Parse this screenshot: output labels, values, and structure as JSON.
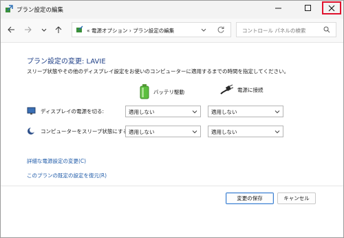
{
  "window": {
    "title": "プラン設定の編集"
  },
  "nav": {
    "address": "« 電源オプション  ›  プラン設定の編集",
    "search_placeholder": "コントロール パネルの検索"
  },
  "main": {
    "heading": "プラン設定の変更: LAVIE",
    "description": "スリープ状態やその他のディスプレイ設定をお使いのコンピューターに適用するまでの時間を指定してください。",
    "columns": {
      "battery": "バッテリ駆動",
      "plugged": "電源に接続"
    },
    "rows": [
      {
        "label": "ディスプレイの電源を切る:",
        "battery": "適用しない",
        "plugged": "適用しない"
      },
      {
        "label": "コンピューターをスリープ状態にする:",
        "battery": "適用しない",
        "plugged": "適用しない"
      }
    ],
    "links": {
      "advanced": "詳細な電源設定の変更(C)",
      "restore": "このプランの既定の設定を復元(R)"
    }
  },
  "footer": {
    "save": "変更の保存",
    "cancel": "キャンセル"
  },
  "colors": {
    "heading": "#1e3f87",
    "link": "#1e5aa8",
    "close_highlight": "#e0112d"
  }
}
